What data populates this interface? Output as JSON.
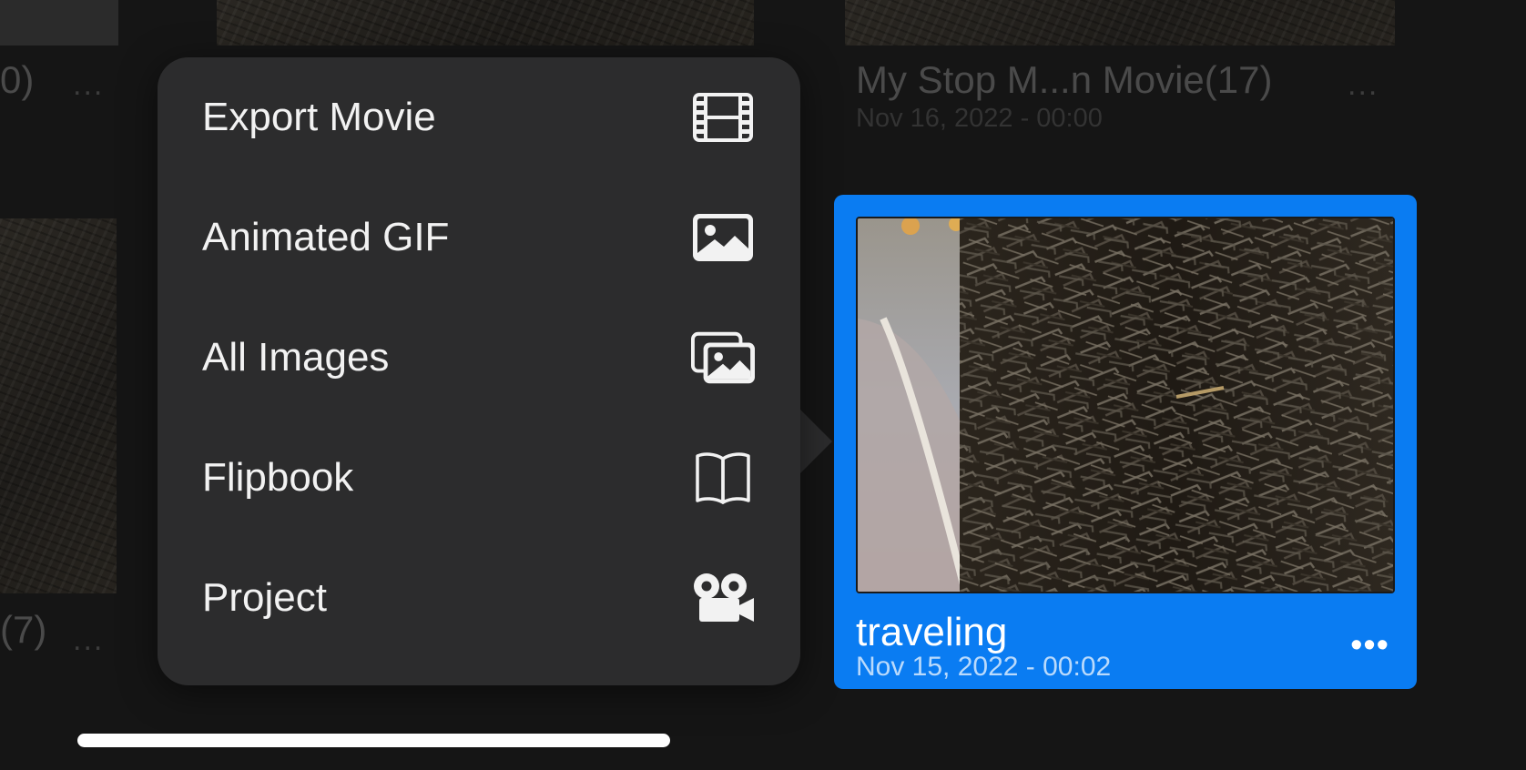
{
  "background_gallery": {
    "items": [
      {
        "title": "0)",
        "date": ""
      },
      {
        "title": "My Stop M...n Movie(17)",
        "date": "Nov 16, 2022 - 00:00"
      },
      {
        "title": "(7)",
        "date": ""
      }
    ],
    "more_label": "..."
  },
  "export_menu": {
    "items": [
      {
        "label": "Export Movie",
        "icon": "film-icon"
      },
      {
        "label": "Animated GIF",
        "icon": "photo-icon"
      },
      {
        "label": "All Images",
        "icon": "photo-stack-icon"
      },
      {
        "label": "Flipbook",
        "icon": "book-icon"
      },
      {
        "label": "Project",
        "icon": "video-camera-icon"
      }
    ]
  },
  "selected_project": {
    "title": "traveling",
    "date": "Nov 15, 2022 - 00:02",
    "more_label": "•••",
    "accent_color": "#0a7cf2"
  }
}
